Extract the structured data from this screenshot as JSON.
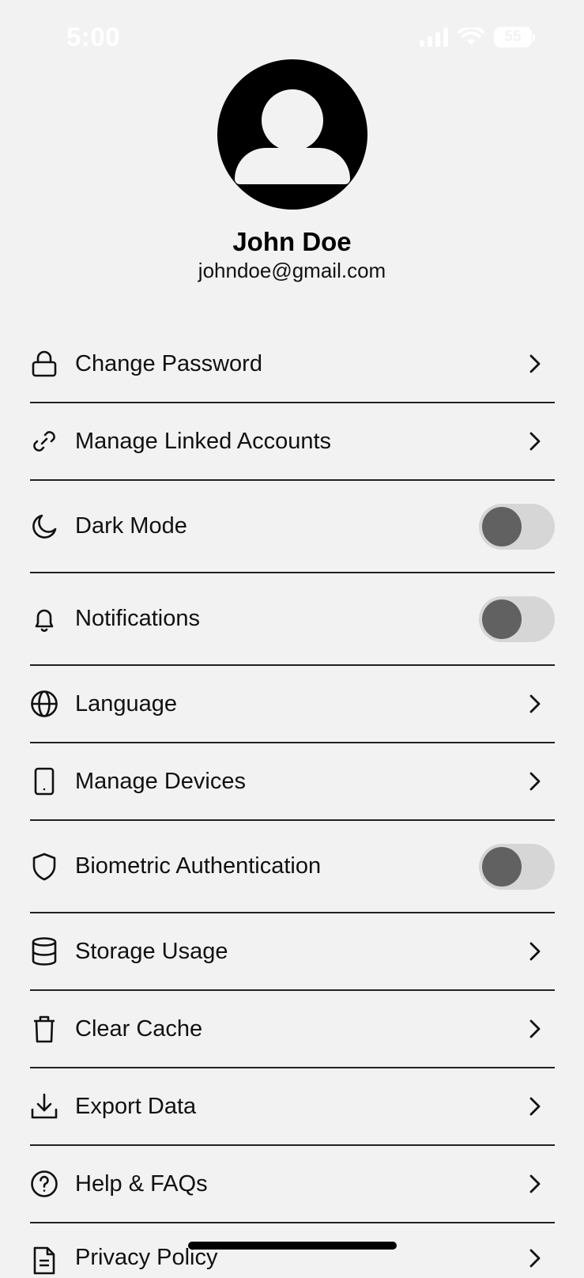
{
  "status_bar": {
    "time": "5:00",
    "battery": "55"
  },
  "profile": {
    "name": "John Doe",
    "email": "johndoe@gmail.com"
  },
  "settings": [
    {
      "label": "Change Password",
      "icon": "lock-icon",
      "control": "chevron"
    },
    {
      "label": "Manage Linked Accounts",
      "icon": "link-icon",
      "control": "chevron"
    },
    {
      "label": "Dark Mode",
      "icon": "moon-icon",
      "control": "toggle",
      "on": false
    },
    {
      "label": "Notifications",
      "icon": "bell-icon",
      "control": "toggle",
      "on": false
    },
    {
      "label": "Language",
      "icon": "globe-icon",
      "control": "chevron"
    },
    {
      "label": "Manage Devices",
      "icon": "phone-icon",
      "control": "chevron"
    },
    {
      "label": "Biometric Authentication",
      "icon": "shield-icon",
      "control": "toggle",
      "on": false
    },
    {
      "label": "Storage Usage",
      "icon": "database-icon",
      "control": "chevron"
    },
    {
      "label": "Clear Cache",
      "icon": "trash-icon",
      "control": "chevron"
    },
    {
      "label": "Export Data",
      "icon": "download-icon",
      "control": "chevron"
    },
    {
      "label": "Help & FAQs",
      "icon": "help-circle-icon",
      "control": "chevron"
    },
    {
      "label": "Privacy Policy",
      "icon": "document-icon",
      "control": "chevron"
    }
  ]
}
